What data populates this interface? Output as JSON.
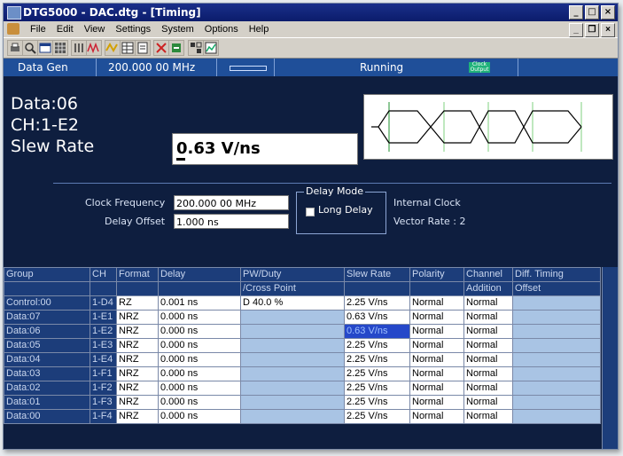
{
  "window": {
    "title": "DTG5000 - DAC.dtg - [Timing]"
  },
  "menu": [
    "File",
    "Edit",
    "View",
    "Settings",
    "System",
    "Options",
    "Help"
  ],
  "toolbar_icons": [
    "print-icon",
    "preview-icon",
    "window-icon",
    "grid-icon",
    "list-icon",
    "wave-icon",
    "timing-icon",
    "table-icon",
    "doc-icon",
    "cut-icon",
    "tools-icon",
    "blocks-icon",
    "chart-icon"
  ],
  "status": {
    "mode": "Data Gen",
    "frequency": "200.000 00 MHz",
    "state": "Running",
    "clock_output": "Clock Output"
  },
  "info": {
    "line1": "Data:06",
    "line2": "CH:1-E2",
    "line3": "Slew Rate",
    "value": "0.63 V/ns",
    "clock_frequency_label": "Clock Frequency",
    "clock_frequency": "200.000 00 MHz",
    "delay_offset_label": "Delay Offset",
    "delay_offset": "1.000 ns",
    "delay_mode_label": "Delay Mode",
    "long_delay_label": "Long Delay",
    "internal_clock": "Internal Clock",
    "vector_rate": "Vector Rate : 2"
  },
  "table": {
    "headers1": [
      "Group",
      "CH",
      "Format",
      "Delay",
      "PW/Duty",
      "Slew Rate",
      "Polarity",
      "Channel",
      "Diff. Timing"
    ],
    "headers2": [
      "",
      "",
      "",
      "",
      "/Cross Point",
      "",
      "",
      "Addition",
      "Offset"
    ],
    "rows": [
      {
        "group": "Control:00",
        "ch": "1-D4",
        "format": "RZ",
        "delay": "0.001 ns",
        "pw": "D 40.0 %",
        "slew": "2.25 V/ns",
        "polarity": "Normal",
        "channel": "Normal",
        "diff": ""
      },
      {
        "group": "Data:07",
        "ch": "1-E1",
        "format": "NRZ",
        "delay": "0.000 ns",
        "pw": "",
        "slew": "0.63 V/ns",
        "polarity": "Normal",
        "channel": "Normal",
        "diff": ""
      },
      {
        "group": "Data:06",
        "ch": "1-E2",
        "format": "NRZ",
        "delay": "0.000 ns",
        "pw": "",
        "slew": "0.63 V/ns",
        "polarity": "Normal",
        "channel": "Normal",
        "diff": ""
      },
      {
        "group": "Data:05",
        "ch": "1-E3",
        "format": "NRZ",
        "delay": "0.000 ns",
        "pw": "",
        "slew": "2.25 V/ns",
        "polarity": "Normal",
        "channel": "Normal",
        "diff": ""
      },
      {
        "group": "Data:04",
        "ch": "1-E4",
        "format": "NRZ",
        "delay": "0.000 ns",
        "pw": "",
        "slew": "2.25 V/ns",
        "polarity": "Normal",
        "channel": "Normal",
        "diff": ""
      },
      {
        "group": "Data:03",
        "ch": "1-F1",
        "format": "NRZ",
        "delay": "0.000 ns",
        "pw": "",
        "slew": "2.25 V/ns",
        "polarity": "Normal",
        "channel": "Normal",
        "diff": ""
      },
      {
        "group": "Data:02",
        "ch": "1-F2",
        "format": "NRZ",
        "delay": "0.000 ns",
        "pw": "",
        "slew": "2.25 V/ns",
        "polarity": "Normal",
        "channel": "Normal",
        "diff": ""
      },
      {
        "group": "Data:01",
        "ch": "1-F3",
        "format": "NRZ",
        "delay": "0.000 ns",
        "pw": "",
        "slew": "2.25 V/ns",
        "polarity": "Normal",
        "channel": "Normal",
        "diff": ""
      },
      {
        "group": "Data:00",
        "ch": "1-F4",
        "format": "NRZ",
        "delay": "0.000 ns",
        "pw": "",
        "slew": "2.25 V/ns",
        "polarity": "Normal",
        "channel": "Normal",
        "diff": ""
      }
    ],
    "selected_row": 2
  }
}
